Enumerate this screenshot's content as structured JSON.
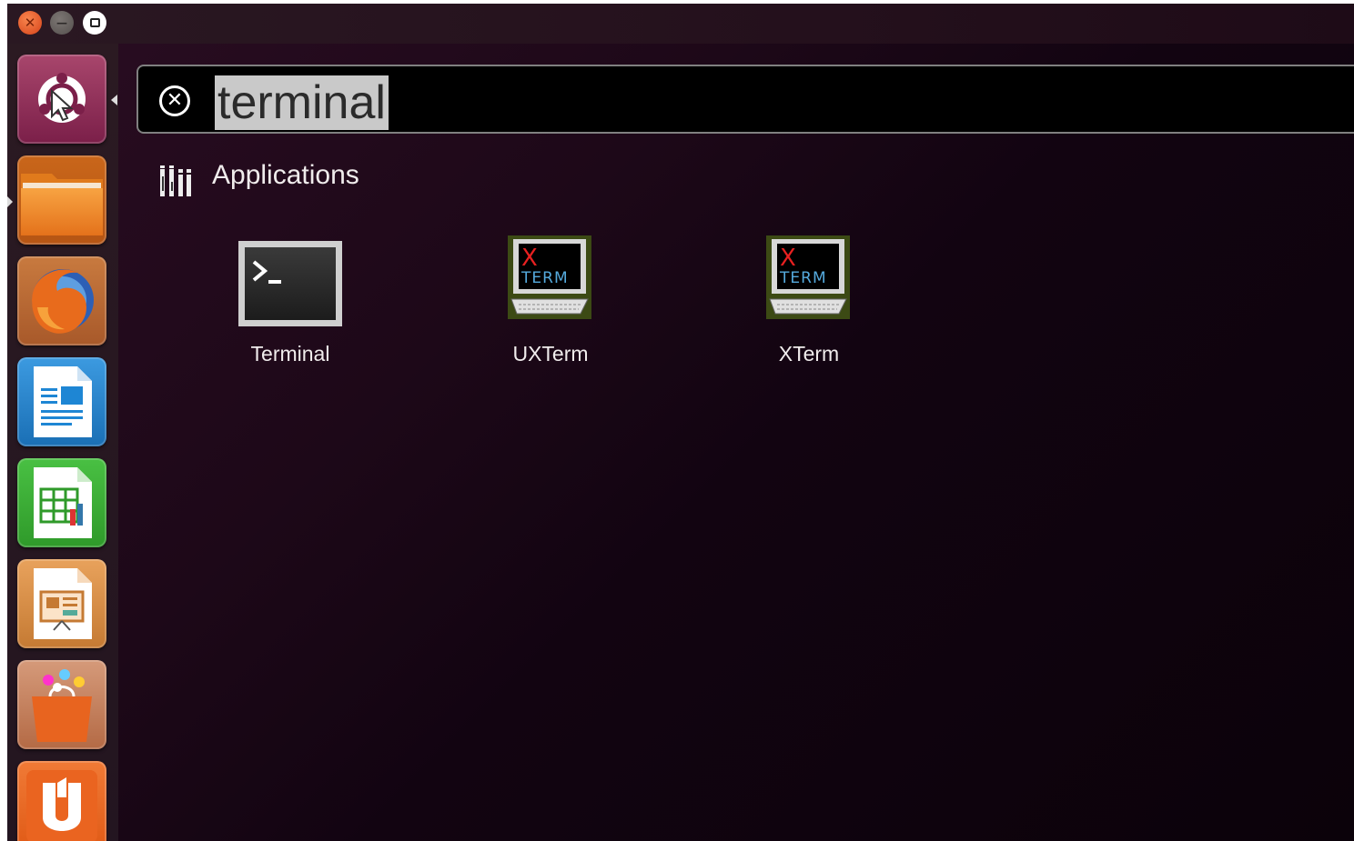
{
  "window": {
    "controls": [
      "close-icon",
      "minimize-icon",
      "maximize-icon"
    ],
    "close_glyph": "✕",
    "min_glyph": "—"
  },
  "launcher": {
    "items": [
      {
        "name": "Dash home",
        "icon": "ubuntu-logo-icon"
      },
      {
        "name": "Files",
        "icon": "folder-icon"
      },
      {
        "name": "Firefox",
        "icon": "firefox-icon"
      },
      {
        "name": "LibreOffice Writer",
        "icon": "writer-icon"
      },
      {
        "name": "LibreOffice Calc",
        "icon": "calc-icon"
      },
      {
        "name": "LibreOffice Impress",
        "icon": "impress-icon"
      },
      {
        "name": "Ubuntu Software Center",
        "icon": "software-center-icon"
      },
      {
        "name": "Ubuntu One",
        "icon": "ubuntu-one-icon"
      }
    ]
  },
  "search": {
    "query": "terminal",
    "clear_glyph": "✕"
  },
  "category": {
    "label": "Applications",
    "icon": "applications-icon"
  },
  "results": [
    {
      "label": "Terminal",
      "icon": "terminal-icon"
    },
    {
      "label": "UXTerm",
      "icon": "xterm-icon"
    },
    {
      "label": "XTerm",
      "icon": "xterm-icon"
    }
  ],
  "xterm_icon_text": {
    "x": "X",
    "term": "TERM"
  },
  "terminal_icon_text": {
    "prompt": ">_"
  },
  "colors": {
    "accent": "#e95420",
    "background": "#1d0818",
    "dash_home": "#8a2a52",
    "folder": "#f08a1c",
    "writer": "#1e86d4",
    "calc": "#3aaa35",
    "impress": "#d98f4a",
    "software_center": "#c96a3a",
    "ubuntu_one": "#e8641f"
  }
}
